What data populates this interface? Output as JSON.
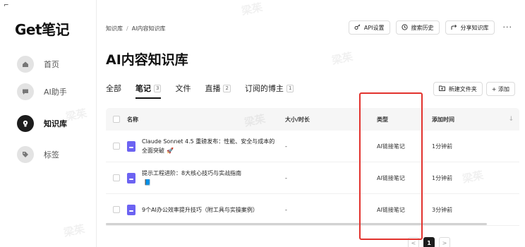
{
  "app": {
    "logo": "Get笔记",
    "corner_mark": "⌐"
  },
  "sidebar": {
    "items": [
      {
        "label": "首页",
        "icon": "home-icon",
        "active": false
      },
      {
        "label": "AI助手",
        "icon": "chat-icon",
        "active": false
      },
      {
        "label": "知识库",
        "icon": "lightbulb-icon",
        "active": true
      },
      {
        "label": "标签",
        "icon": "tag-icon",
        "active": false
      }
    ]
  },
  "breadcrumb": {
    "root": "知识库",
    "separator": "/",
    "current": "AI内容知识库"
  },
  "header": {
    "actions": [
      {
        "label": "API设置",
        "icon": "key-icon"
      },
      {
        "label": "搜索历史",
        "icon": "history-icon"
      },
      {
        "label": "分享知识库",
        "icon": "share-icon"
      }
    ],
    "more": "···"
  },
  "page": {
    "title": "AI内容知识库"
  },
  "tabs": [
    {
      "label": "全部",
      "count": ""
    },
    {
      "label": "笔记",
      "count": "3"
    },
    {
      "label": "文件",
      "count": ""
    },
    {
      "label": "直播",
      "count": "2"
    },
    {
      "label": "订阅的博主",
      "count": "1"
    }
  ],
  "tab_actions": {
    "new_folder": "新建文件夹",
    "add": "+ 添加"
  },
  "table": {
    "headers": {
      "name": "名称",
      "size": "大小/时长",
      "type": "类型",
      "time": "添加时间"
    },
    "rows": [
      {
        "title": "Claude Sonnet 4.5 重磅发布：性能、安全与成本的全面突破",
        "emoji": "🚀",
        "size": "-",
        "type": "AI链接笔记",
        "time": "1分钟前"
      },
      {
        "title": "提示工程进阶：8大核心技巧与实战指南",
        "emoji": "📘",
        "size": "-",
        "type": "AI链接笔记",
        "time": "1分钟前"
      },
      {
        "title": "9个AI办公效率提升技巧（附工具与实操案例）",
        "emoji": "",
        "size": "-",
        "type": "AI链接笔记",
        "time": "3分钟前"
      }
    ]
  },
  "pagination": {
    "prev": "<",
    "current": "1",
    "next": ">"
  },
  "watermark": "梁茱",
  "colors": {
    "highlight": "#e2322d",
    "doc_icon": "#6c63f2",
    "active_nav": "#1c1c1c"
  }
}
